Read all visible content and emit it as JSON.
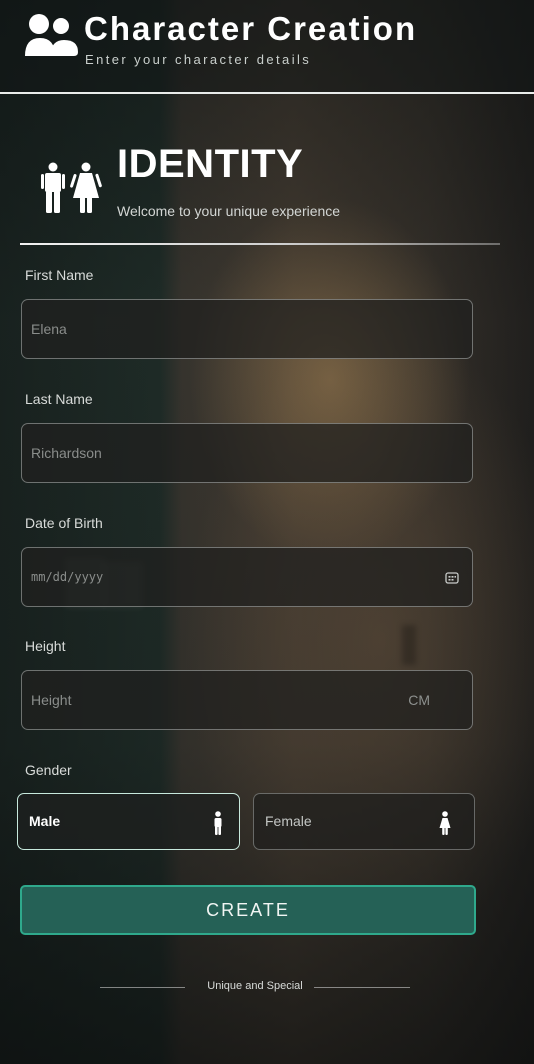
{
  "header": {
    "title": "Character Creation",
    "subtitle": "Enter your character details",
    "icon": "users-icon"
  },
  "identity": {
    "title": "IDENTITY",
    "subtitle": "Welcome to your unique experience",
    "icon": "restroom-icon"
  },
  "form": {
    "first_name": {
      "label": "First Name",
      "placeholder": "Elena",
      "value": ""
    },
    "last_name": {
      "label": "Last Name",
      "placeholder": "Richardson",
      "value": ""
    },
    "dob": {
      "label": "Date of Birth",
      "placeholder": "mm/dd/yyyy",
      "value": "",
      "icon": "calendar-icon"
    },
    "height": {
      "label": "Height",
      "placeholder": "Height",
      "unit": "CM",
      "value": ""
    },
    "gender": {
      "label": "Gender",
      "options": [
        {
          "label": "Male",
          "icon": "male-icon",
          "selected": true
        },
        {
          "label": "Female",
          "icon": "female-icon",
          "selected": false
        }
      ]
    }
  },
  "create_button": {
    "label": "CREATE"
  },
  "footer": {
    "text": "Unique and Special"
  },
  "colors": {
    "accent": "#2fa98c",
    "button_fill": "#256156",
    "selected_border": "#c7e9dd"
  }
}
